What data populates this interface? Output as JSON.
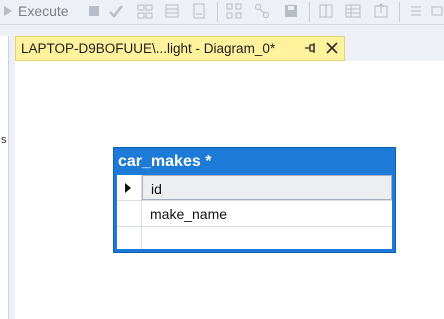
{
  "toolbar": {
    "execute_label": "Execute",
    "icons": [
      "execute-icon",
      "stop-icon",
      "verify-icon",
      "table-icon",
      "view-icon",
      "page-icon",
      "relationship-icon",
      "network-icon",
      "save-icon",
      "columns-icon",
      "grid-icon",
      "export-icon",
      "list-icon"
    ]
  },
  "tab": {
    "title": "LAPTOP-D9BOFUUE\\...light - Diagram_0*",
    "pin_symbol": "⊣",
    "close_symbol": "✕"
  },
  "left_strip": {
    "glyph": "s"
  },
  "table": {
    "name": "car_makes *",
    "columns": [
      {
        "name": "id",
        "selected": true
      },
      {
        "name": "make_name",
        "selected": false
      },
      {
        "name": "",
        "selected": false
      }
    ]
  },
  "colors": {
    "tab_active": "#fff29d",
    "table_header": "#1d7ad6",
    "toolbar_bg": "#eef0f7"
  }
}
